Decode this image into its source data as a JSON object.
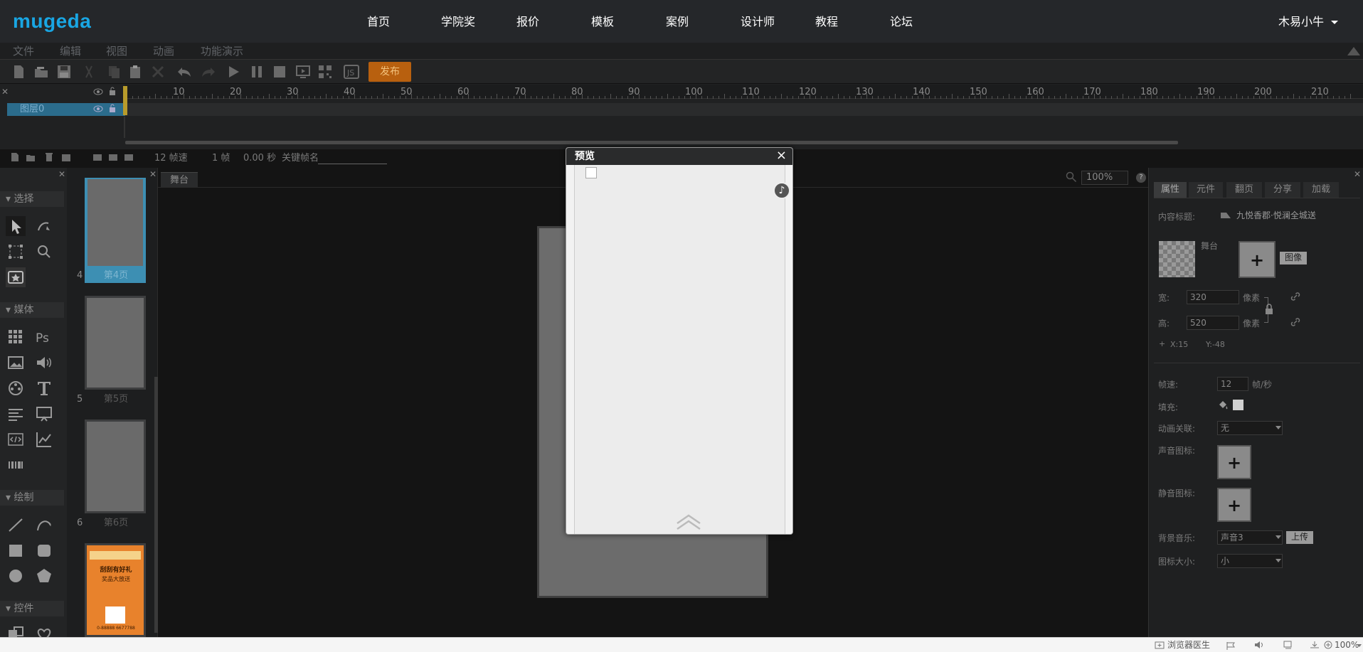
{
  "topnav": {
    "logo": "mugeda",
    "items": [
      "首页",
      "学院奖",
      "报价",
      "模板",
      "案例",
      "设计师",
      "教程",
      "论坛"
    ],
    "user": "木易小牛"
  },
  "menubar": {
    "items": [
      "文件",
      "编辑",
      "视图",
      "动画",
      "功能演示"
    ]
  },
  "toolbar": {
    "publish_label": "发布",
    "icons": [
      "new-file-icon",
      "open-folder-icon",
      "save-icon",
      "cut-icon",
      "copy-icon",
      "paste-icon",
      "delete-icon",
      "undo-icon",
      "redo-icon",
      "play-icon",
      "pause-icon",
      "stop-icon",
      "preview-screen-icon",
      "qr-code-icon",
      "js-icon"
    ]
  },
  "timeline": {
    "ticks": [
      "10",
      "20",
      "30",
      "40",
      "50",
      "60",
      "70",
      "80",
      "90",
      "100",
      "110",
      "120",
      "130",
      "140",
      "150",
      "160",
      "170",
      "180",
      "190",
      "200",
      "210"
    ],
    "layer_name": "图层0",
    "status": {
      "fps": "12 帧速",
      "frame": "1 帧",
      "time": "0.00 秒",
      "keyframe_label": "关键帧名"
    }
  },
  "left_tools": {
    "sections": [
      "选择",
      "媒体",
      "绘制",
      "控件"
    ]
  },
  "pages": [
    {
      "num": "4",
      "label": "第4页",
      "active": true
    },
    {
      "num": "5",
      "label": "第5页",
      "active": false
    },
    {
      "num": "6",
      "label": "第6页",
      "active": false
    },
    {
      "num": "",
      "label": "",
      "active": false
    }
  ],
  "thumb7": {
    "headline": "刮刮有好礼",
    "subline": "奖品大放送",
    "phone": "0-88888 6677788"
  },
  "stage": {
    "tab": "舞台",
    "zoom": "100%",
    "help": "?"
  },
  "right_panel": {
    "tabs": [
      "属性",
      "元件",
      "翻页",
      "分享",
      "加载"
    ],
    "content_title_label": "内容标题:",
    "content_title_value": "九悦香郡·悦澜全城送",
    "stage_label": "舞台",
    "image_btn": "图像",
    "width_label": "宽:",
    "width_value": "320",
    "height_label": "高:",
    "height_value": "520",
    "unit": "像素",
    "x_coord": "X:15",
    "y_coord": "Y:-48",
    "plus_sign": "+",
    "fps_label": "帧速:",
    "fps_value": "12",
    "fps_unit": "帧/秒",
    "fill_label": "填充:",
    "anim_link_label": "动画关联:",
    "anim_link_value": "无",
    "sound_icon_label": "声音图标:",
    "mute_icon_label": "静音图标:",
    "bgm_label": "背景音乐:",
    "bgm_value": "声音3",
    "upload_btn": "上传",
    "icon_size_label": "图标大小:",
    "icon_size_value": "小"
  },
  "modal": {
    "title": "预览",
    "close": "×",
    "music_glyph": "♪"
  },
  "statusbar": {
    "doctor": "浏览器医生",
    "zoom": "100%"
  }
}
